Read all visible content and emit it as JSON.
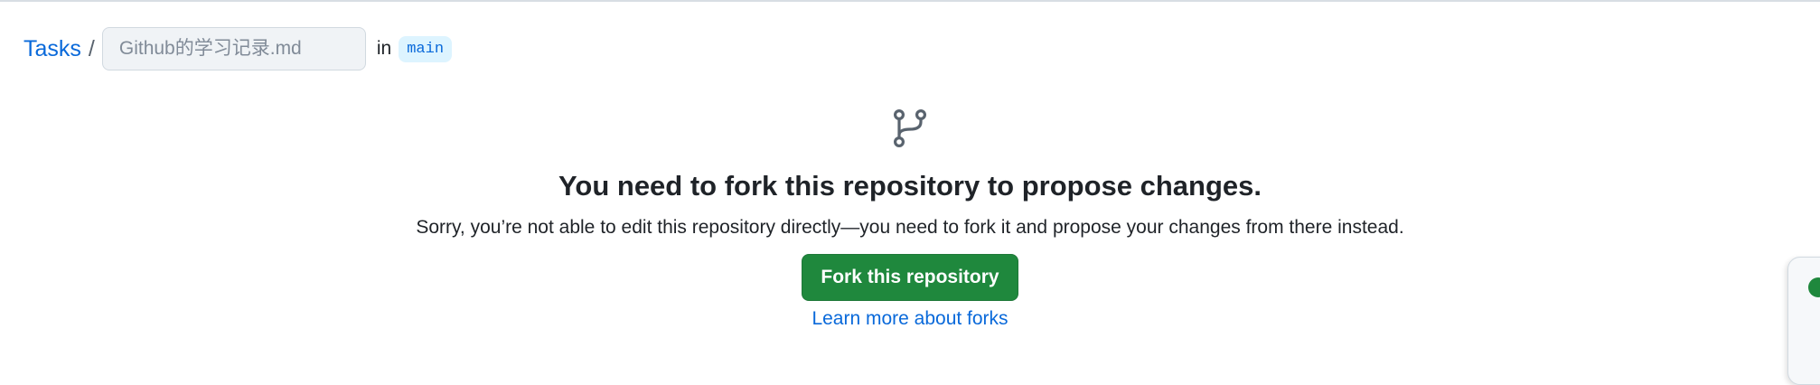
{
  "breadcrumb": {
    "repo_link": "Tasks",
    "separator": "/",
    "filename_placeholder": "Github的学习记录.md",
    "in_label": "in",
    "branch": "main"
  },
  "blank_slate": {
    "icon": "git-fork-icon",
    "title": "You need to fork this repository to propose changes.",
    "description": "Sorry, you’re not able to edit this repository directly—you need to fork it and propose your changes from there instead.",
    "fork_button_label": "Fork this repository",
    "learn_more_link": "Learn more about forks"
  },
  "colors": {
    "link": "#0969da",
    "primary_button": "#1f883d",
    "branch_chip_bg": "#ddf4ff",
    "input_bg": "#f0f3f6"
  }
}
